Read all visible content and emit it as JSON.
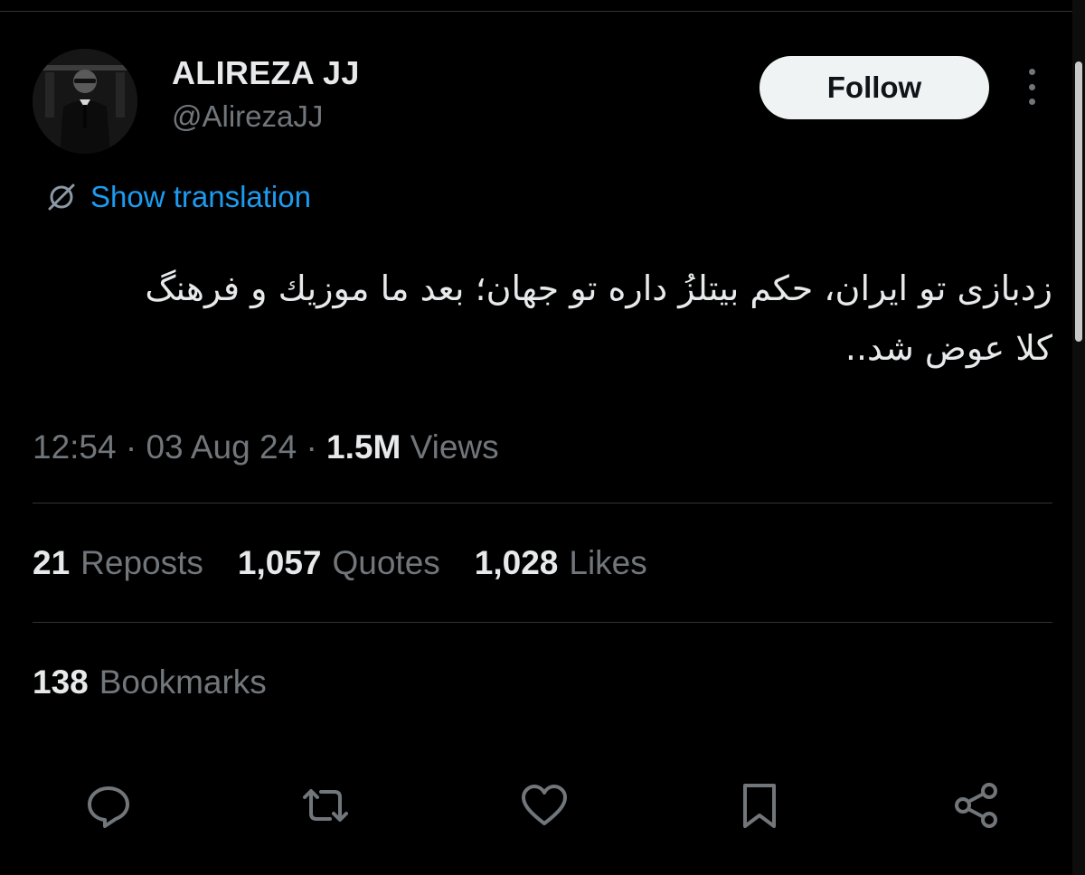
{
  "author": {
    "display_name": "ALIREZA JJ",
    "handle": "@AlirezaJJ"
  },
  "header": {
    "follow_label": "Follow",
    "more_icon": "more-vertical-icon"
  },
  "translation": {
    "label": "Show translation",
    "icon": "globe-slash-icon"
  },
  "tweet": {
    "line1": "زدبازی تو ایران، حکم بیتلزُ داره تو جهان؛ بعد ما موزیك و فرهنگ",
    "line2": "کلا عوض شد.."
  },
  "meta": {
    "time": "12:54",
    "sep1": "·",
    "date": "03 Aug 24",
    "sep2": "·",
    "views_count": "1.5M",
    "views_label": "Views"
  },
  "stats": {
    "reposts": {
      "count": "21",
      "label": "Reposts"
    },
    "quotes": {
      "count": "1,057",
      "label": "Quotes"
    },
    "likes": {
      "count": "1,028",
      "label": "Likes"
    }
  },
  "bookmarks": {
    "count": "138",
    "label": "Bookmarks"
  },
  "actions": [
    "reply-icon",
    "repost-icon",
    "like-icon",
    "bookmark-icon",
    "share-icon"
  ],
  "colors": {
    "background": "#000000",
    "text_primary": "#e7e9ea",
    "text_secondary": "#71767b",
    "accent": "#1d9bf0",
    "divider": "#2f3336",
    "follow_bg": "#eff3f4"
  }
}
